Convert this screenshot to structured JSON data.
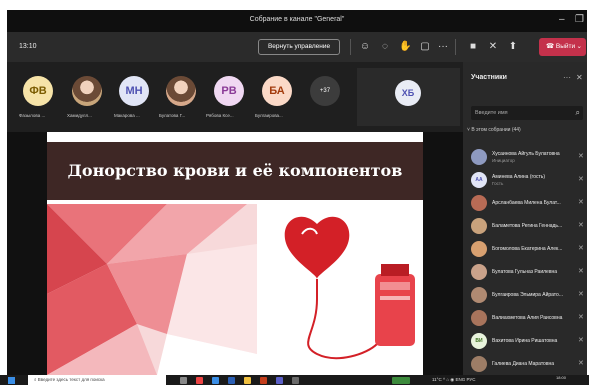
{
  "window": {
    "title": "Собрание в канале \"General\""
  },
  "toolbar": {
    "timer": "13:10",
    "reclaim_label": "Вернуть управление",
    "leave_label": "Выйти"
  },
  "participants_strip": {
    "avatars": [
      {
        "initials": "ФВ",
        "name": "Фазылова ...",
        "bg": "#f6e3a8",
        "fg": "#7a5b00",
        "photo": false
      },
      {
        "initials": "",
        "name": "Хамидулл...",
        "bg": "#c8a57a",
        "fg": "#000",
        "photo": true
      },
      {
        "initials": "МН",
        "name": "Макарова ...",
        "bg": "#e1e5f6",
        "fg": "#4f52b2",
        "photo": false
      },
      {
        "initials": "",
        "name": "Булатова Г...",
        "bg": "#d6a88a",
        "fg": "#000",
        "photo": true
      },
      {
        "initials": "РВ",
        "name": "Рябова Ксе...",
        "bg": "#f0d8f2",
        "fg": "#8a3a97",
        "photo": false
      },
      {
        "initials": "БА",
        "name": "Булгаирова...",
        "bg": "#fbd9c7",
        "fg": "#a33b0c",
        "photo": false
      }
    ],
    "more_count": "+37",
    "tile_initials": "ХБ"
  },
  "slide": {
    "title": "Донорство крови и её компонентов"
  },
  "panel": {
    "title": "Участники",
    "search_placeholder": "Введите имя",
    "group_label": "В этом собрании (44)",
    "people": [
      {
        "name": "Хусаинова Айгуль Булатовна",
        "role": "Инициатор",
        "initials": "",
        "bg": "#8e9ac0",
        "fg": "#fff"
      },
      {
        "name": "Аминева Алина (гость)",
        "role": "Гость",
        "initials": "АА",
        "bg": "#e1e5f6",
        "fg": "#4f52b2"
      },
      {
        "name": "Арсланбаева Милена Булат...",
        "role": "",
        "initials": "",
        "bg": "#b86b55",
        "fg": "#fff"
      },
      {
        "name": "Баламетова Регина Геннадь...",
        "role": "",
        "initials": "",
        "bg": "#c9a27c",
        "fg": "#fff"
      },
      {
        "name": "Богомолова Екатерина Алек...",
        "role": "",
        "initials": "",
        "bg": "#d8a070",
        "fg": "#fff"
      },
      {
        "name": "Булатова Гульназ Раилевна",
        "role": "",
        "initials": "",
        "bg": "#caa28a",
        "fg": "#fff"
      },
      {
        "name": "Булгаирова Эльмира Айрато...",
        "role": "",
        "initials": "",
        "bg": "#b08a72",
        "fg": "#fff"
      },
      {
        "name": "Валиахметова Алия Раисовна",
        "role": "",
        "initials": "",
        "bg": "#a8745c",
        "fg": "#fff"
      },
      {
        "name": "Вахитова Ирина Ришатовна",
        "role": "",
        "initials": "ВИ",
        "bg": "#e8f3dc",
        "fg": "#3c6e1e"
      },
      {
        "name": "Галиева Диана Маратовна",
        "role": "",
        "initials": "",
        "bg": "#9d7d66",
        "fg": "#fff"
      }
    ]
  },
  "taskbar": {
    "search_placeholder": "Введите здесь текст для поиска",
    "tray_text": "11°C  ^  ⌂  ◉  ENG  РУС",
    "time": "18:00",
    "date": ""
  },
  "colors": {
    "leave": "#c4314b",
    "accent": "#4f52b2"
  }
}
